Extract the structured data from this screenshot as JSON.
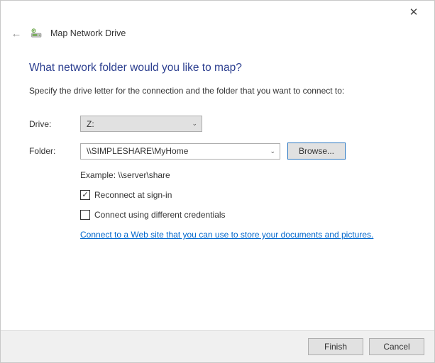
{
  "window": {
    "title": "Map Network Drive"
  },
  "heading": "What network folder would you like to map?",
  "instruction": "Specify the drive letter for the connection and the folder that you want to connect to:",
  "form": {
    "drive_label": "Drive:",
    "drive_value": "Z:",
    "folder_label": "Folder:",
    "folder_value": "\\\\SIMPLESHARE\\MyHome",
    "browse_label": "Browse...",
    "example_text": "Example: \\\\server\\share",
    "reconnect_label": "Reconnect at sign-in",
    "reconnect_checked": true,
    "credentials_label": "Connect using different credentials",
    "credentials_checked": false,
    "website_link": "Connect to a Web site that you can use to store your documents and pictures."
  },
  "footer": {
    "finish_label": "Finish",
    "cancel_label": "Cancel"
  }
}
